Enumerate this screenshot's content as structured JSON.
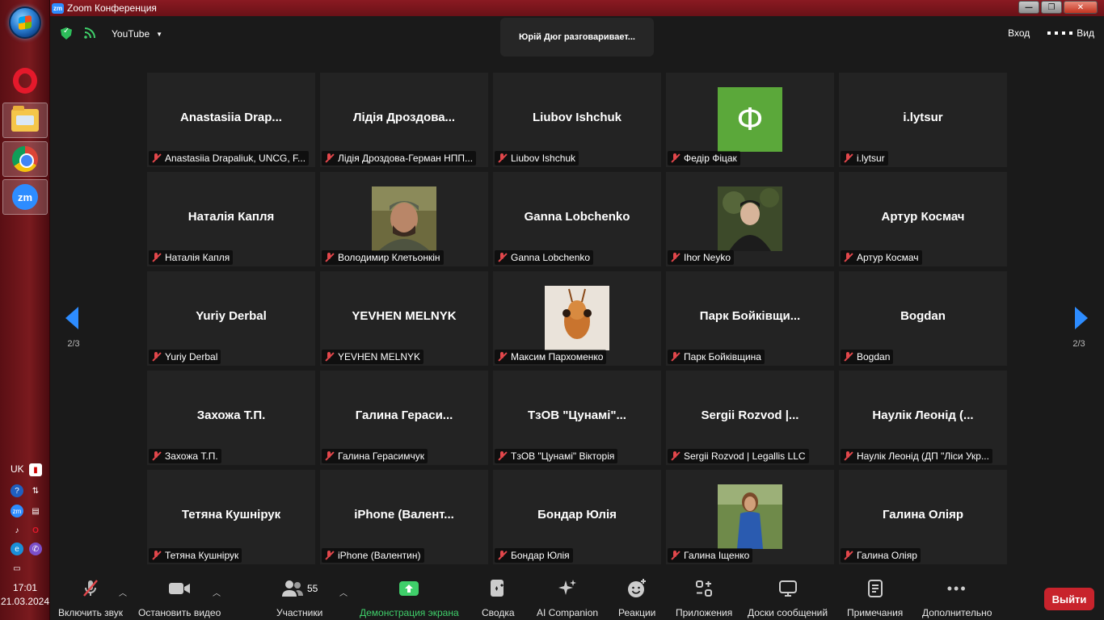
{
  "window": {
    "title": "Zoom Конференция"
  },
  "topbar": {
    "stream_label": "YouTube",
    "speaking": "Юрій Дюг разговаривает...",
    "enter_label": "Вход",
    "view_label": "Вид"
  },
  "pagination": {
    "left": "2/3",
    "right": "2/3"
  },
  "tiles": [
    {
      "name": "Anastasiia Drap...",
      "label": "Anastasiia Drapaliuk, UNCG, F..."
    },
    {
      "name": "Лідія  Дроздова...",
      "label": "Лідія Дроздова-Герман НПП..."
    },
    {
      "name": "Liubov Ishchuk",
      "label": "Liubov Ishchuk"
    },
    {
      "name": "",
      "label": "Федір Фіцак",
      "avatar_letter": "Ф"
    },
    {
      "name": "i.lytsur",
      "label": "i.lytsur"
    },
    {
      "name": "Наталія Капля",
      "label": "Наталія Капля"
    },
    {
      "name": "",
      "label": "Володимир Клетьонкін",
      "photo": "man-cap"
    },
    {
      "name": "Ganna Lobchenko",
      "label": "Ganna Lobchenko"
    },
    {
      "name": "",
      "label": "Ihor Neyko",
      "photo": "man-dark"
    },
    {
      "name": "Артур Космач",
      "label": "Артур Космач"
    },
    {
      "name": "Yuriy Derbal",
      "label": "Yuriy Derbal"
    },
    {
      "name": "YEVHEN MELNYK",
      "label": "YEVHEN MELNYK"
    },
    {
      "name": "",
      "label": "Максим Пархоменко",
      "photo": "insect"
    },
    {
      "name": "Парк  Бойківщи...",
      "label": "Парк Бойківщина"
    },
    {
      "name": "Bogdan",
      "label": "Bogdan"
    },
    {
      "name": "Захожа Т.П.",
      "label": "Захожа Т.П."
    },
    {
      "name": "Галина  Гераси...",
      "label": "Галина Герасимчук"
    },
    {
      "name": "ТзОВ  \"Цунамі\"...",
      "label": "ТзОВ \"Цунамі\" Вікторія"
    },
    {
      "name": "Sergii  Rozvod  |...",
      "label": "Sergii Rozvod | Legallis LLC"
    },
    {
      "name": "Наулік  Леонід  (...",
      "label": "Наулік Леонід (ДП \"Ліси Укр..."
    },
    {
      "name": "Тетяна Кушнірук",
      "label": "Тетяна Кушнірук"
    },
    {
      "name": "iPhone  (Валент...",
      "label": "iPhone (Валентин)"
    },
    {
      "name": "Бондар Юлія",
      "label": "Бондар Юлія"
    },
    {
      "name": "",
      "label": "Галина Іщенко",
      "photo": "woman"
    },
    {
      "name": "Галина Оліяр",
      "label": "Галина Оліяр"
    }
  ],
  "toolbar": {
    "mute": "Включить звук",
    "video": "Остановить видео",
    "participants": "Участники",
    "participants_count": "55",
    "share": "Демонстрация экрана",
    "summary": "Сводка",
    "ai": "AI Companion",
    "reactions": "Реакции",
    "apps": "Приложения",
    "whiteboards": "Доски сообщений",
    "notes": "Примечания",
    "more": "Дополнительно",
    "leave": "Выйти"
  },
  "tray": {
    "lang": "UK",
    "time": "17:01",
    "date": "21.03.2024"
  },
  "colors": {
    "accent": "#2d8cff",
    "leave": "#c8232c",
    "muted": "#e2474b",
    "share": "#3fcf6a"
  }
}
